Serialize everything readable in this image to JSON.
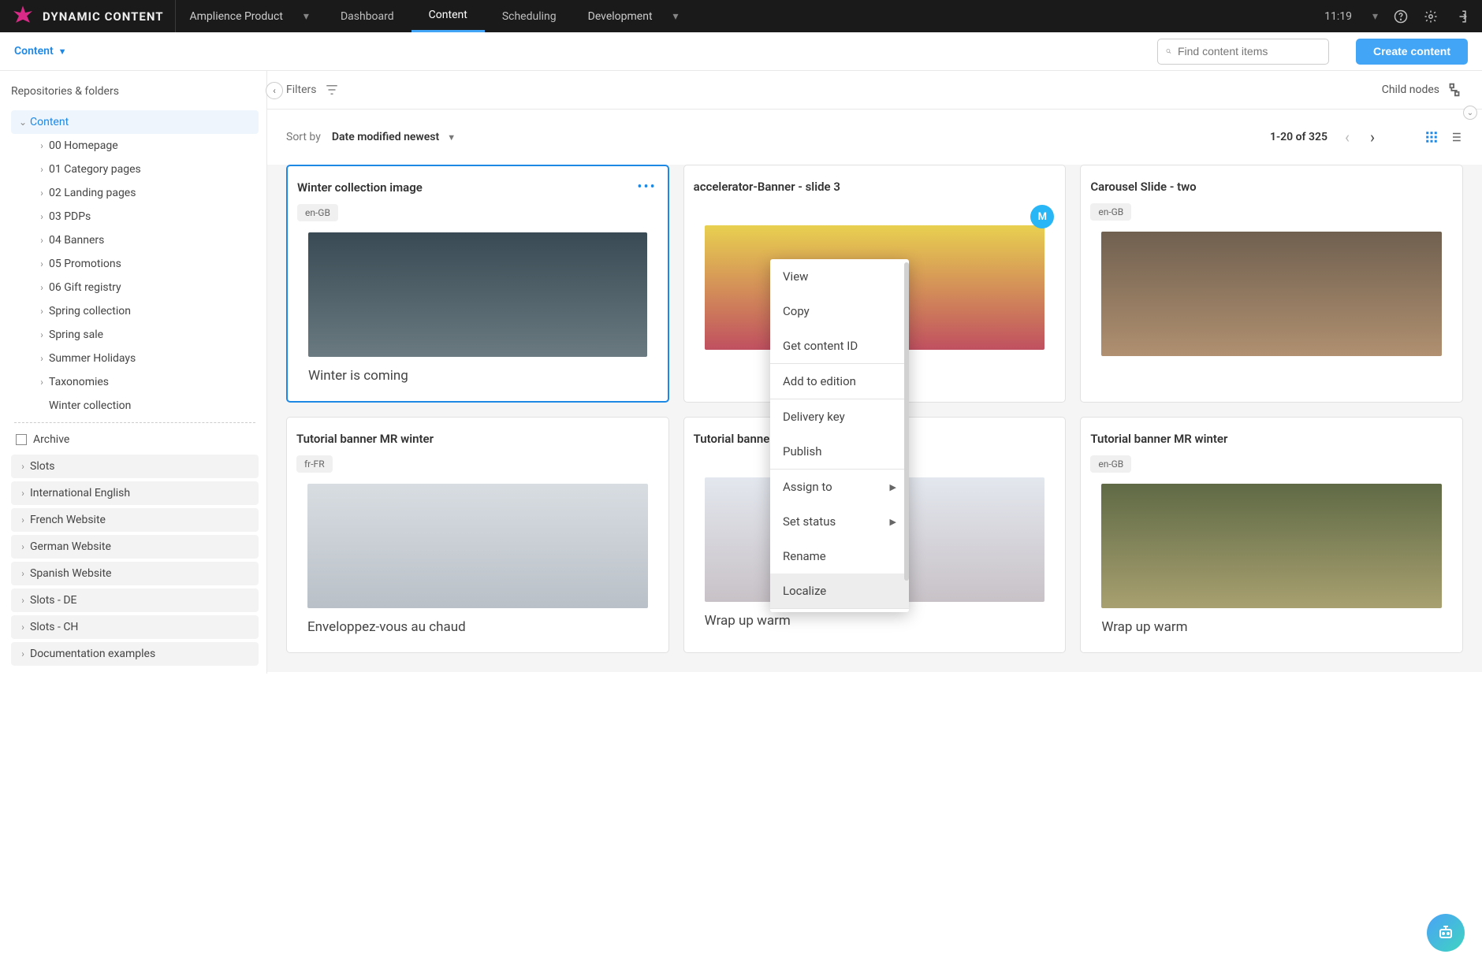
{
  "header": {
    "brand": "DYNAMIC CONTENT",
    "product_dd": "Amplience Product",
    "tabs": [
      "Dashboard",
      "Content",
      "Scheduling"
    ],
    "active_tab": 1,
    "env_dd": "Development",
    "time": "11:19"
  },
  "subheader": {
    "breadcrumb": "Content",
    "search_placeholder": "Find content items",
    "create_label": "Create content"
  },
  "sidebar": {
    "title": "Repositories & folders",
    "root": "Content",
    "folders": [
      "00 Homepage",
      "01 Category pages",
      "02 Landing pages",
      "03 PDPs",
      "04 Banners",
      "05 Promotions",
      "06 Gift registry",
      "Spring collection",
      "Spring sale",
      "Summer Holidays",
      "Taxonomies",
      "Winter collection"
    ],
    "archive": "Archive",
    "repos": [
      "Slots",
      "International English",
      "French Website",
      "German Website",
      "Spanish Website",
      "Slots - DE",
      "Slots - CH",
      "Documentation examples"
    ]
  },
  "toolbar": {
    "filters": "Filters",
    "child_nodes": "Child nodes",
    "sort_by": "Sort by",
    "sort_value": "Date modified newest",
    "range": "1-20 of 325"
  },
  "cards": [
    {
      "title": "Winter collection image",
      "locale": "en-GB",
      "caption": "Winter is coming",
      "img": "img-winter",
      "selected": true,
      "more": true
    },
    {
      "title": "accelerator-Banner - slide 3",
      "locale": "",
      "caption": "",
      "img": "img-flowers",
      "avatar": "M"
    },
    {
      "title": "Carousel Slide - two",
      "locale": "en-GB",
      "caption": "",
      "img": "img-carousel"
    },
    {
      "title": "Tutorial banner MR winter",
      "locale": "fr-FR",
      "caption": "Enveloppez-vous au chaud",
      "img": "img-beanie"
    },
    {
      "title": "Tutorial banner MR winter",
      "locale": "",
      "caption": "Wrap up warm",
      "img": "img-snow",
      "title_prefix_hidden": true
    },
    {
      "title": "Tutorial banner MR winter",
      "locale": "en-GB",
      "caption": "Wrap up warm",
      "img": "img-phone"
    }
  ],
  "context_menu": {
    "items": [
      {
        "label": "View"
      },
      {
        "label": "Copy"
      },
      {
        "label": "Get content ID",
        "sep_after": true
      },
      {
        "label": "Add to edition",
        "sep_after": true
      },
      {
        "label": "Delivery key"
      },
      {
        "label": "Publish",
        "sep_after": true
      },
      {
        "label": "Assign to",
        "submenu": true
      },
      {
        "label": "Set status",
        "submenu": true
      },
      {
        "label": "Rename"
      },
      {
        "label": "Localize",
        "hover": true,
        "sep_after": true
      }
    ]
  }
}
